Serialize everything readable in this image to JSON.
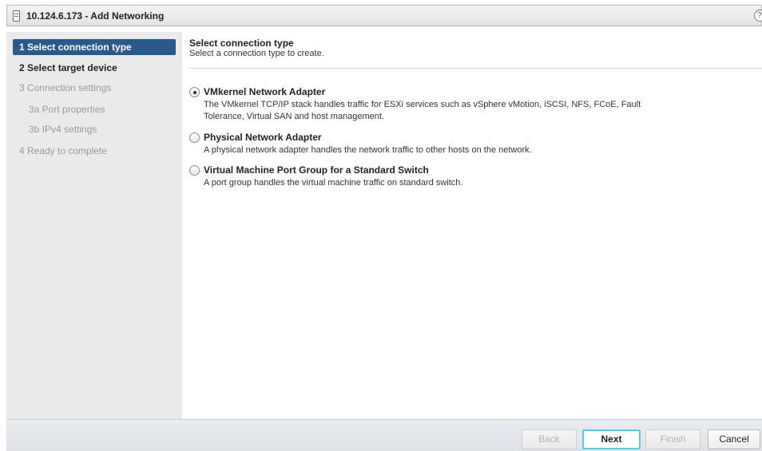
{
  "window": {
    "title": "10.124.6.173 - Add Networking",
    "help_glyph": "?"
  },
  "steps": [
    {
      "label": "1  Select connection type",
      "state": "active"
    },
    {
      "label": "2  Select target device",
      "state": "enabled"
    },
    {
      "label": "3  Connection settings",
      "state": "disabled"
    },
    {
      "label": "3a  Port properties",
      "state": "disabled"
    },
    {
      "label": "3b  IPv4 settings",
      "state": "disabled"
    },
    {
      "label": "4  Ready to complete",
      "state": "disabled"
    }
  ],
  "main": {
    "heading": "Select connection type",
    "subheading": "Select a connection type to create.",
    "options": [
      {
        "title": "VMkernel Network Adapter",
        "description": "The VMkernel TCP/IP stack handles traffic for  ESXi services such as vSphere vMotion, iSCSI, NFS, FCoE, Fault Tolerance, Virtual SAN and host management.",
        "selected": true
      },
      {
        "title": "Physical Network Adapter",
        "description": "A physical network adapter handles the network traffic to other hosts on the network.",
        "selected": false
      },
      {
        "title": "Virtual Machine Port Group for a Standard Switch",
        "description": "A port group handles the virtual machine traffic on standard switch.",
        "selected": false
      }
    ]
  },
  "footer": {
    "back_label": "Back",
    "next_label": "Next",
    "finish_label": "Finish",
    "cancel_label": "Cancel"
  },
  "colors": {
    "active_step_bg": "#2a5a8c",
    "primary_focus": "#5ec8e0"
  }
}
